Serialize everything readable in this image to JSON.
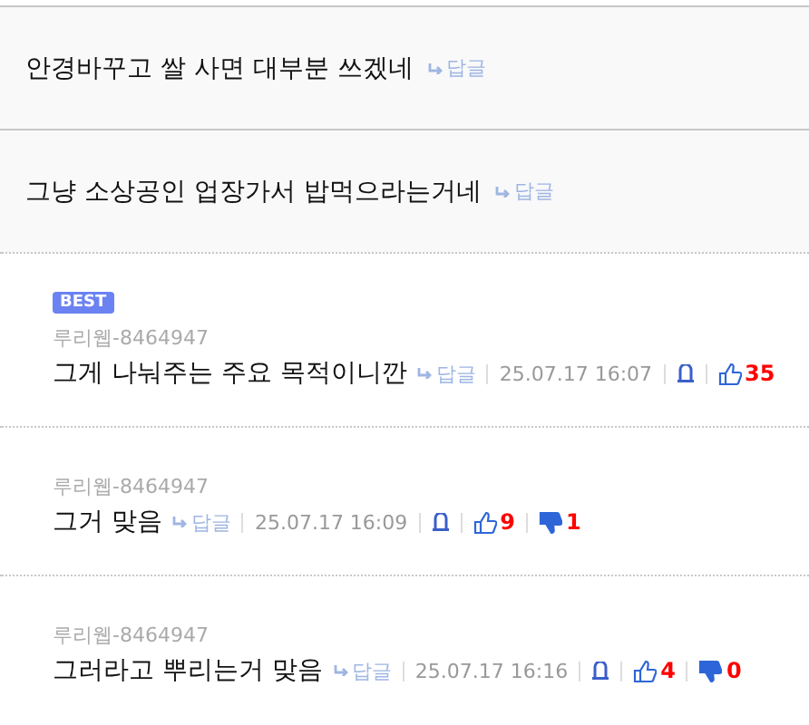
{
  "comments": [
    {
      "kind": "top",
      "text": "안경바꾸고 쌀 사면 대부분 쓰겠네",
      "reply": "답글"
    },
    {
      "kind": "top",
      "text": "그냥 소상공인 업장가서 밥먹으라는거네",
      "reply": "답글"
    },
    {
      "kind": "sub",
      "best": true,
      "badge": "BEST",
      "author": "루리웹-8464947",
      "text": "그게 나눠주는 주요 목적이니깐",
      "reply": "답글",
      "time": "25.07.17 16:07",
      "likes": "35"
    },
    {
      "kind": "sub",
      "best": false,
      "author": "루리웹-8464947",
      "text": "그거 맞음",
      "reply": "답글",
      "time": "25.07.17 16:09",
      "likes": "9",
      "dislikes": "1"
    },
    {
      "kind": "sub",
      "best": false,
      "author": "루리웹-8464947",
      "text": "그러라고 뿌리는거 맞음",
      "reply": "답글",
      "time": "25.07.17 16:16",
      "likes": "4",
      "dislikes": "0"
    }
  ]
}
